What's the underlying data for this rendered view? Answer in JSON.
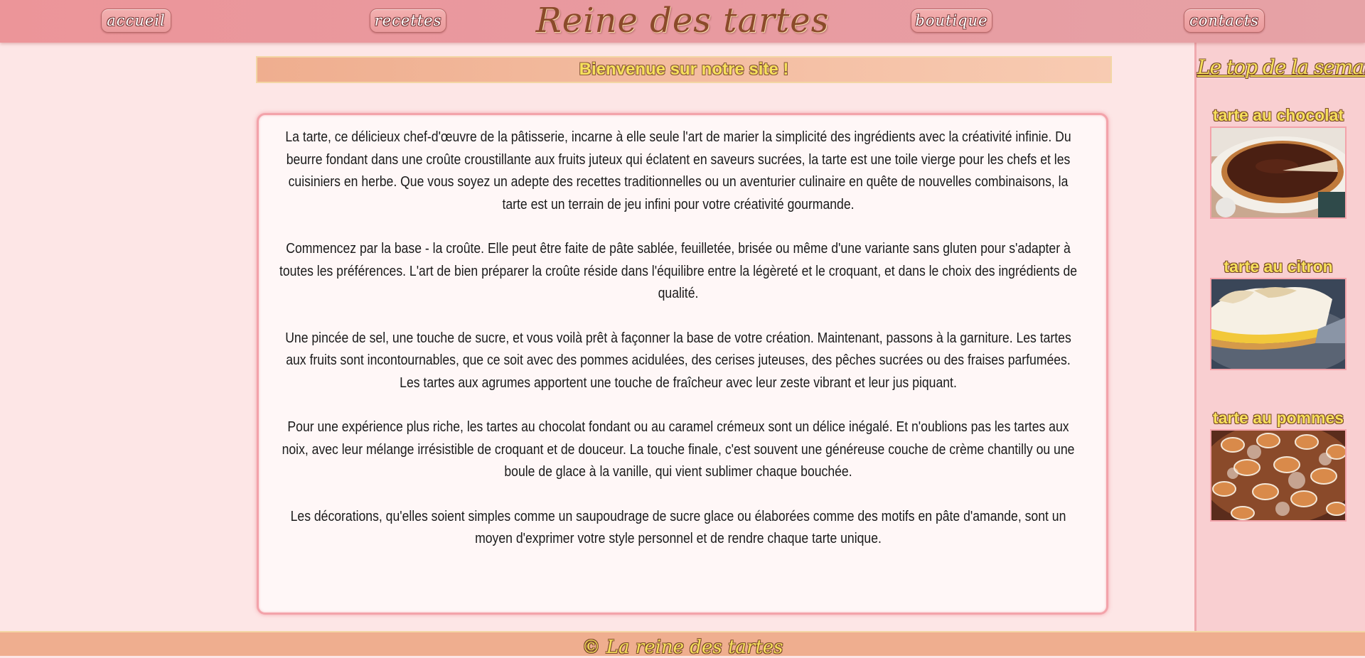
{
  "nav": {
    "items": [
      "accueil",
      "recettes",
      "boutique",
      "contacts"
    ],
    "site_title": "Reine des tartes"
  },
  "welcome": "Bienvenue sur notre site !",
  "article": {
    "paragraphs": [
      "La tarte, ce délicieux chef-d'œuvre de la pâtisserie, incarne à elle seule l'art de marier la simplicité des ingrédients avec la créativité infinie. Du beurre fondant dans une croûte croustillante aux fruits juteux qui éclatent en saveurs sucrées, la tarte est une toile vierge pour les chefs et les cuisiniers en herbe. Que vous soyez un adepte des recettes traditionnelles ou un aventurier culinaire en quête de nouvelles combinaisons, la tarte est un terrain de jeu infini pour votre créativité gourmande.",
      "Commencez par la base - la croûte. Elle peut être faite de pâte sablée, feuilletée, brisée ou même d'une variante sans gluten pour s'adapter à toutes les préférences. L'art de bien préparer la croûte réside dans l'équilibre entre la légèreté et le croquant, et dans le choix des ingrédients de qualité.",
      "Une pincée de sel, une touche de sucre, et vous voilà prêt à façonner la base de votre création. Maintenant, passons à la garniture. Les tartes aux fruits sont incontournables, que ce soit avec des pommes acidulées, des cerises juteuses, des pêches sucrées ou des fraises parfumées. Les tartes aux agrumes apportent une touche de fraîcheur avec leur zeste vibrant et leur jus piquant.",
      "Pour une expérience plus riche, les tartes au chocolat fondant ou au caramel crémeux sont un délice inégalé. Et n'oublions pas les tartes aux noix, avec leur mélange irrésistible de croquant et de douceur. La touche finale, c'est souvent une généreuse couche de crème chantilly ou une boule de glace à la vanille, qui vient sublimer chaque bouchée.",
      "Les décorations, qu'elles soient simples comme un saupoudrage de sucre glace ou élaborées comme des motifs en pâte d'amande, sont un moyen d'exprimer votre style personnel et de rendre chaque tarte unique."
    ]
  },
  "sidebar": {
    "title": "Le top de la semaine",
    "items": [
      {
        "label": "tarte au chocolat"
      },
      {
        "label": "tarte au citron"
      },
      {
        "label": "tarte au pommes"
      }
    ]
  },
  "footer": "© La reine des tartes"
}
